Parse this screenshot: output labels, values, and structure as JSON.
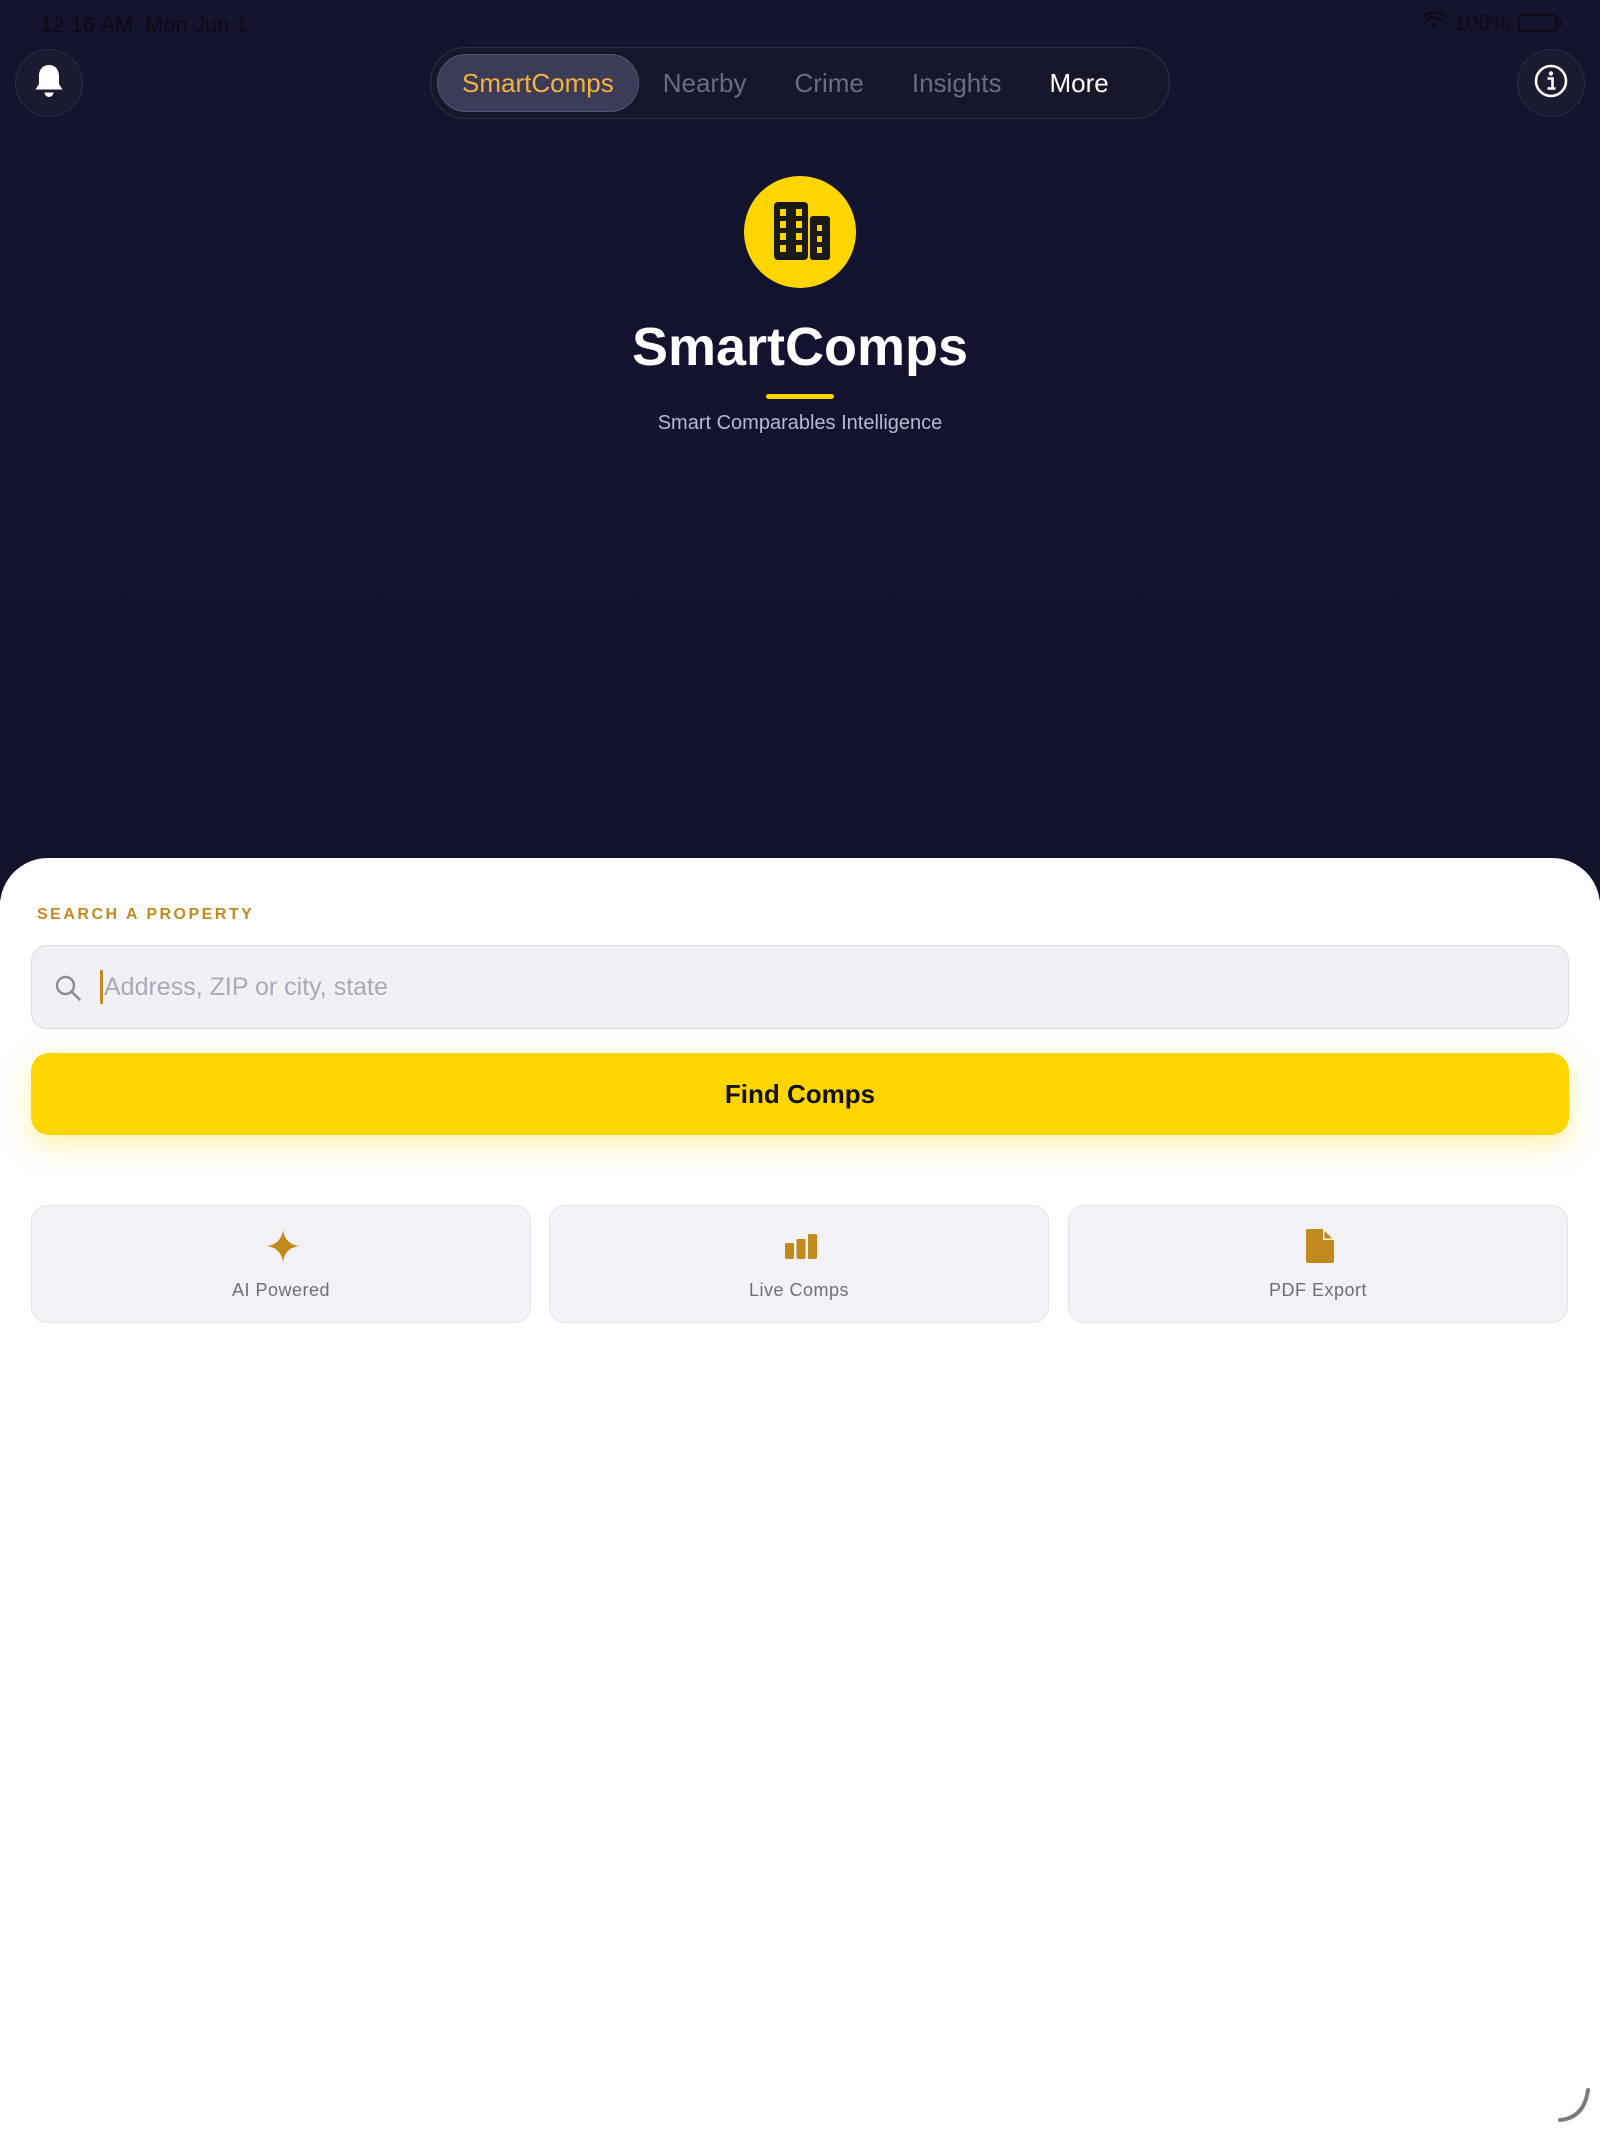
{
  "status_bar": {
    "time": "12:16 AM",
    "date": "Mon Jun 1",
    "battery": "100%"
  },
  "header": {
    "tabs": [
      {
        "label": "SmartComps",
        "active": true
      },
      {
        "label": "Nearby",
        "active": false
      },
      {
        "label": "Crime",
        "active": false
      },
      {
        "label": "Insights",
        "active": false
      },
      {
        "label": "More",
        "active": false
      }
    ],
    "left_icon": "bell-icon",
    "right_icon": "info-icon"
  },
  "hero": {
    "logo_icon": "building-icon",
    "title": "SmartComps",
    "subtitle": "Smart Comparables Intelligence"
  },
  "search": {
    "section_label": "SEARCH A PROPERTY",
    "placeholder": "Address, ZIP or city, state",
    "value": "",
    "button_label": "Find Comps"
  },
  "features": [
    {
      "label": "AI Powered",
      "icon": "sparkle-icon"
    },
    {
      "label": "Live Comps",
      "icon": "bar-chart-icon"
    },
    {
      "label": "PDF Export",
      "icon": "document-icon"
    }
  ],
  "colors": {
    "accent_yellow": "#FFD500",
    "accent_gold": "#C18A1D",
    "hero_background": "#14142E"
  }
}
